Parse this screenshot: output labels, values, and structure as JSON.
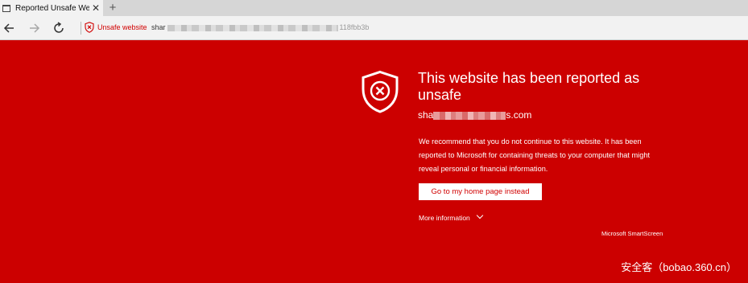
{
  "browser": {
    "tab": {
      "title": "Reported Unsafe Websi",
      "close_glyph": "✕",
      "icon": "page-icon"
    },
    "new_tab_glyph": "+",
    "nav": {
      "back_icon": "back-arrow-icon",
      "forward_icon": "forward-arrow-icon",
      "refresh_icon": "refresh-icon"
    },
    "address": {
      "security_label": "Unsafe website",
      "url_start": "shar",
      "url_end": "118fbb3b"
    }
  },
  "warning": {
    "heading": "This website has been reported as unsafe",
    "domain_start": "sha",
    "domain_end": "s.com",
    "message": "We recommend that you do not continue to this website. It has been reported to Microsoft for containing threats to your computer that might reveal personal or financial information.",
    "home_button": "Go to my home page instead",
    "more_info": "More information",
    "provider": "Microsoft SmartScreen"
  },
  "watermark": "安全客（bobao.360.cn）",
  "colors": {
    "background": "#cc0000",
    "unsafe_text": "#d10000",
    "text": "#ffffff"
  }
}
